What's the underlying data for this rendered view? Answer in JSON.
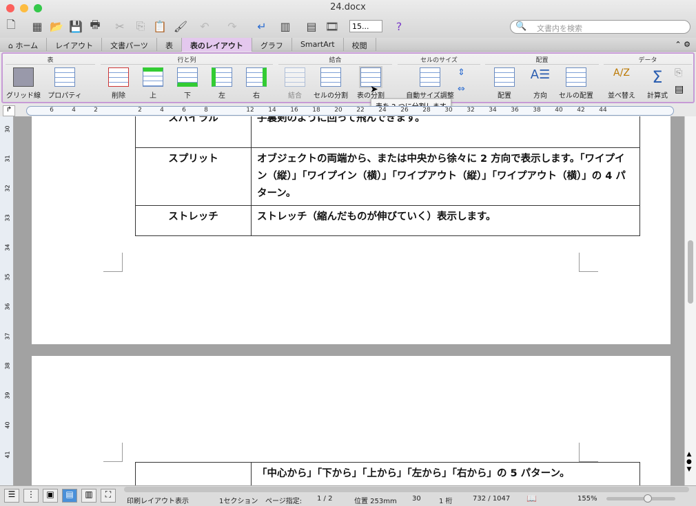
{
  "window": {
    "title": "24.docx"
  },
  "toolbar": {
    "zoom_value": "15...",
    "search_placeholder": "文書内を検索"
  },
  "tabs": [
    {
      "label": "ホーム"
    },
    {
      "label": "レイアウト"
    },
    {
      "label": "文書パーツ"
    },
    {
      "label": "表"
    },
    {
      "label": "表のレイアウト",
      "active": true
    },
    {
      "label": "グラフ"
    },
    {
      "label": "SmartArt"
    },
    {
      "label": "校閲"
    }
  ],
  "ribbon": {
    "groups": [
      "表",
      "行と列",
      "結合",
      "セルのサイズ",
      "配置",
      "データ"
    ],
    "buttons": [
      "グリッド線",
      "プロパティ",
      "削除",
      "上",
      "下",
      "左",
      "右",
      "結合",
      "セルの分割",
      "表の分割",
      "自動サイズ調整",
      "配置",
      "方向",
      "セルの配置",
      "並べ替え",
      "計算式"
    ],
    "tooltip": "表を 2 つに分割します"
  },
  "ruler": {
    "ticks": [
      "6",
      "4",
      "2",
      "",
      "2",
      "4",
      "6",
      "8",
      "",
      "12",
      "14",
      "16",
      "18",
      "20",
      "22",
      "24",
      "26",
      "28",
      "30",
      "32",
      "34",
      "36",
      "38",
      "40",
      "42",
      "44"
    ]
  },
  "vruler": {
    "ticks": [
      "30",
      "31",
      "32",
      "33",
      "34",
      "35",
      "36",
      "37",
      "38",
      "39",
      "40",
      "41"
    ]
  },
  "document": {
    "rows": [
      {
        "name": "スパイラル",
        "desc": "手裏剣のように回って飛んできます。"
      },
      {
        "name": "スプリット",
        "desc": "オブジェクトの両端から、または中央から徐々に 2 方向で表示します。「ワイプイン（縦）」「ワイプイン（横）」「ワイプアウト（縦）」「ワイプアウト（横）」の 4 パターン。"
      },
      {
        "name": "ストレッチ",
        "desc": "ストレッチ（縮んだものが伸びていく）表示します。"
      }
    ],
    "page2_row": {
      "name": "",
      "desc": "「中心から」「下から」「上から」「左から」「右から」の 5 パターン。"
    }
  },
  "status": {
    "view": "印刷レイアウト表示",
    "section": "1セクション",
    "page_label": "ページ指定:",
    "page": "1 / 2",
    "position": "位置 253mm",
    "line": "30",
    "column": "1 桁",
    "words": "732 / 1047",
    "zoom": "155%",
    "zoom_fraction": 0.6
  }
}
